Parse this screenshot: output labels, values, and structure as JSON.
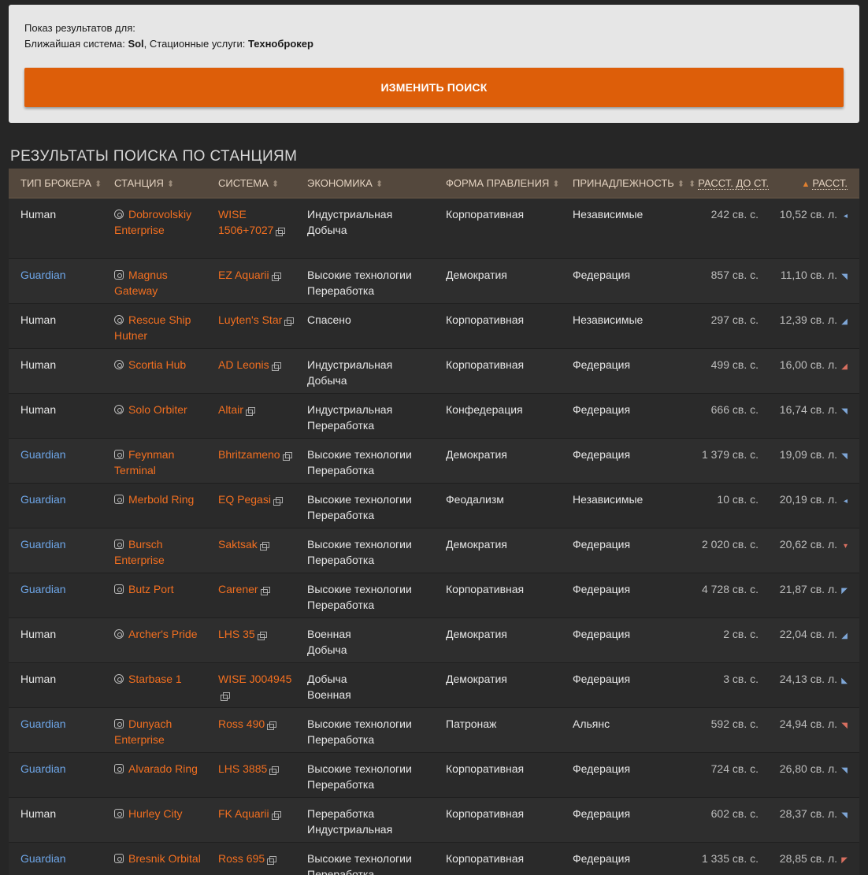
{
  "search": {
    "results_for": "Показ результатов для:",
    "system_label": "Ближайшая система:",
    "system_value": "Sol",
    "services_label": "Стационные услуги:",
    "services_value": "Техноброкер",
    "change_button": "ИЗМЕНИТЬ ПОИСК"
  },
  "section_title": "РЕЗУЛЬТАТЫ ПОИСКА ПО СТАНЦИЯМ",
  "columns": {
    "broker": "ТИП БРОКЕРА",
    "station": "СТАНЦИЯ",
    "system": "СИСТЕМА",
    "economy": "ЭКОНОМИКА",
    "government": "ФОРМА ПРАВЛЕНИЯ",
    "allegiance": "ПРИНАДЛЕЖНОСТЬ",
    "dist_star": "РАССТ. ДО СТ.",
    "dist": "РАССТ."
  },
  "rows": [
    {
      "broker": "Human",
      "station": "Dobrovolskiy Enterprise",
      "system": "WISE 1506+7027",
      "economy1": "Индустриальная",
      "economy2": "Добыча",
      "government": "Корпоративная",
      "allegiance": "Независимые",
      "dist_star": "242 св. с.",
      "dist": "10,52 св. л."
    },
    {
      "broker": "Guardian",
      "station": "Magnus Gateway",
      "system": "EZ Aquarii",
      "economy1": "Высокие технологии",
      "economy2": "Переработка",
      "government": "Демократия",
      "allegiance": "Федерация",
      "dist_star": "857 св. с.",
      "dist": "11,10 св. л."
    },
    {
      "broker": "Human",
      "station": "Rescue Ship Hutner",
      "system": "Luyten's Star",
      "economy1": "Спасено",
      "economy2": "",
      "government": "Корпоративная",
      "allegiance": "Независимые",
      "dist_star": "297 св. с.",
      "dist": "12,39 св. л."
    },
    {
      "broker": "Human",
      "station": "Scortia Hub",
      "system": "AD Leonis",
      "economy1": "Индустриальная",
      "economy2": "Добыча",
      "government": "Корпоративная",
      "allegiance": "Федерация",
      "dist_star": "499 св. с.",
      "dist": "16,00 св. л."
    },
    {
      "broker": "Human",
      "station": "Solo Orbiter",
      "system": "Altair",
      "economy1": "Индустриальная",
      "economy2": "Переработка",
      "government": "Конфедерация",
      "allegiance": "Федерация",
      "dist_star": "666 св. с.",
      "dist": "16,74 св. л."
    },
    {
      "broker": "Guardian",
      "station": "Feynman Terminal",
      "system": "Bhritzameno",
      "economy1": "Высокие технологии",
      "economy2": "Переработка",
      "government": "Демократия",
      "allegiance": "Федерация",
      "dist_star": "1 379 св. с.",
      "dist": "19,09 св. л."
    },
    {
      "broker": "Guardian",
      "station": "Merbold Ring",
      "system": "EQ Pegasi",
      "economy1": "Высокие технологии",
      "economy2": "Переработка",
      "government": "Феодализм",
      "allegiance": "Независимые",
      "dist_star": "10 св. с.",
      "dist": "20,19 св. л."
    },
    {
      "broker": "Guardian",
      "station": "Bursch Enterprise",
      "system": "Saktsak",
      "economy1": "Высокие технологии",
      "economy2": "Переработка",
      "government": "Демократия",
      "allegiance": "Федерация",
      "dist_star": "2 020 св. с.",
      "dist": "20,62 св. л."
    },
    {
      "broker": "Guardian",
      "station": "Butz Port",
      "system": "Carener",
      "economy1": "Высокие технологии",
      "economy2": "Переработка",
      "government": "Корпоративная",
      "allegiance": "Федерация",
      "dist_star": "4 728 св. с.",
      "dist": "21,87 св. л."
    },
    {
      "broker": "Human",
      "station": "Archer's Pride",
      "system": "LHS 35",
      "economy1": "Военная",
      "economy2": "Добыча",
      "government": "Демократия",
      "allegiance": "Федерация",
      "dist_star": "2 св. с.",
      "dist": "22,04 св. л."
    },
    {
      "broker": "Human",
      "station": "Starbase 1",
      "system": "WISE J004945",
      "economy1": "Добыча",
      "economy2": "Военная",
      "government": "Демократия",
      "allegiance": "Федерация",
      "dist_star": "3 св. с.",
      "dist": "24,13 св. л."
    },
    {
      "broker": "Guardian",
      "station": "Dunyach Enterprise",
      "system": "Ross 490",
      "economy1": "Высокие технологии",
      "economy2": "Переработка",
      "government": "Патронаж",
      "allegiance": "Альянс",
      "dist_star": "592 св. с.",
      "dist": "24,94 св. л."
    },
    {
      "broker": "Guardian",
      "station": "Alvarado Ring",
      "system": "LHS 3885",
      "economy1": "Высокие технологии",
      "economy2": "Переработка",
      "government": "Корпоративная",
      "allegiance": "Федерация",
      "dist_star": "724 св. с.",
      "dist": "26,80 св. л."
    },
    {
      "broker": "Human",
      "station": "Hurley City",
      "system": "FK Aquarii",
      "economy1": "Переработка",
      "economy2": "Индустриальная",
      "government": "Корпоративная",
      "allegiance": "Федерация",
      "dist_star": "602 св. с.",
      "dist": "28,37 св. л."
    },
    {
      "broker": "Guardian",
      "station": "Bresnik Orbital",
      "system": "Ross 695",
      "economy1": "Высокие технологии",
      "economy2": "Переработка",
      "government": "Корпоративная",
      "allegiance": "Федерация",
      "dist_star": "1 335 св. с.",
      "dist": "28,85 св. л."
    }
  ],
  "colors": {
    "accent": "#dd5e09",
    "link": "#f26f20",
    "guardian": "#6ea6e8",
    "header_bg": "#54483d"
  }
}
